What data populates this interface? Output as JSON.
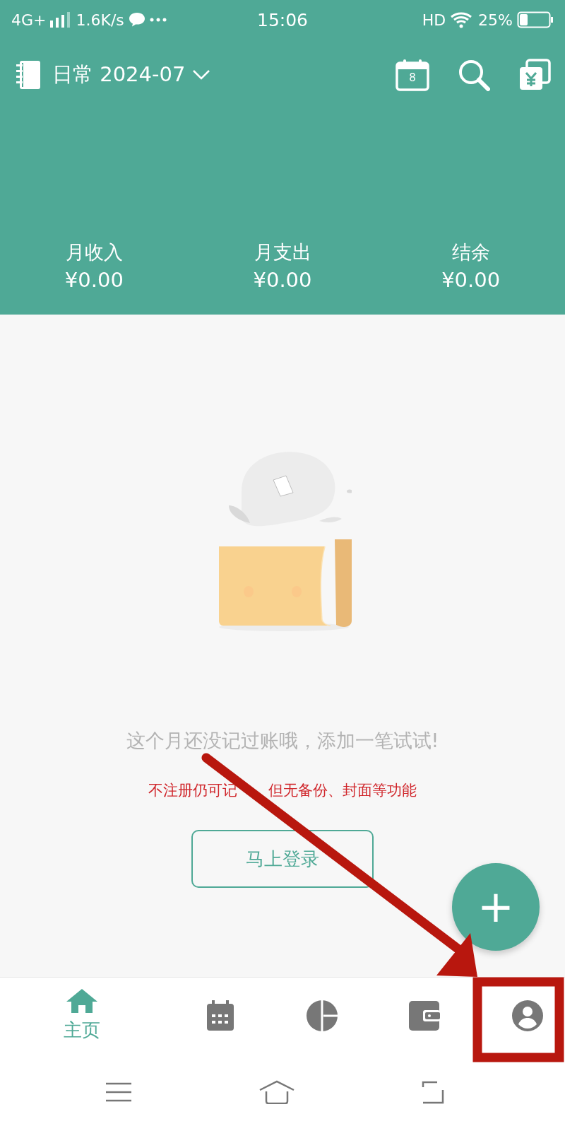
{
  "status_bar": {
    "network": "4G+",
    "speed": "1.6K/s",
    "time": "15:06",
    "hd": "HD",
    "battery": "25%"
  },
  "header": {
    "book_title": "日常 2024-07",
    "calendar_day": "8"
  },
  "summary": [
    {
      "label": "月收入",
      "value": "¥0.00"
    },
    {
      "label": "月支出",
      "value": "¥0.00"
    },
    {
      "label": "结余",
      "value": "¥0.00"
    }
  ],
  "empty_state": {
    "message": "这个月还没记过账哦，添加一笔试试!",
    "notice_parts": [
      "不注册仍可记",
      "但无备份、封面等功能"
    ],
    "login_button": "马上登录"
  },
  "fab": {
    "label": "+"
  },
  "bottom_nav": [
    {
      "kind": "home",
      "label": "主页",
      "selected": true
    },
    {
      "kind": "calendar",
      "selected": false
    },
    {
      "kind": "chart",
      "selected": false
    },
    {
      "kind": "wallet",
      "selected": false
    },
    {
      "kind": "profile",
      "selected": false
    }
  ]
}
